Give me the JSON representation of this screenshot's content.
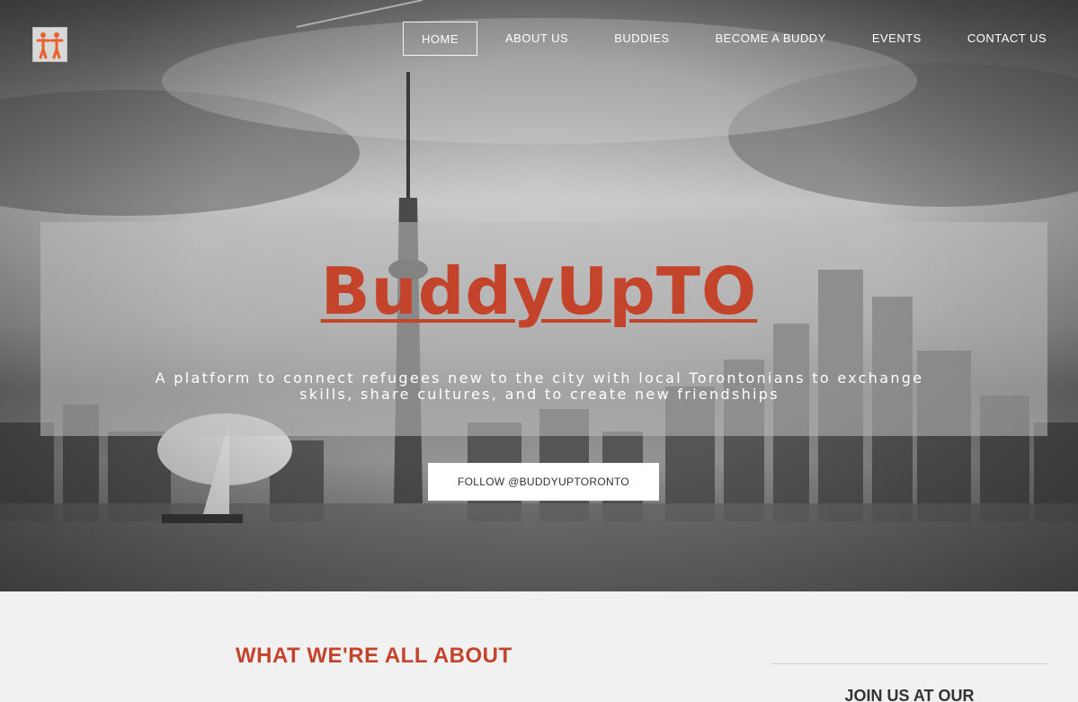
{
  "nav": {
    "items": [
      {
        "label": "HOME",
        "active": true
      },
      {
        "label": "ABOUT US"
      },
      {
        "label": "BUDDIES"
      },
      {
        "label": "BECOME A BUDDY"
      },
      {
        "label": "EVENTS"
      },
      {
        "label": "CONTACT US"
      }
    ]
  },
  "logo": {
    "icon": "two-people-logo-icon",
    "color": "#e8602c"
  },
  "hero": {
    "title": "BuddyUpTO",
    "tagline": "A platform to connect refugees new to the city with local Torontonians to exchange skills, share cultures, and to create new friendships",
    "follow_button": "FOLLOW @BUDDYUPTORONTO"
  },
  "about": {
    "heading": "WHAT WE'RE ALL ABOUT"
  },
  "sidebar": {
    "heading": "JOIN US AT OUR"
  },
  "colors": {
    "accent": "#c4432b",
    "logo": "#e8602c"
  }
}
